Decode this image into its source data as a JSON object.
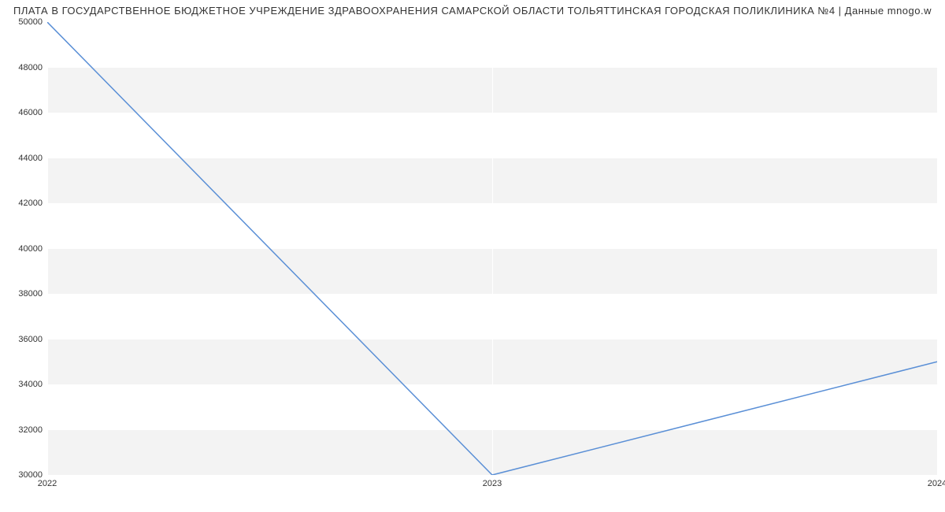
{
  "chart_data": {
    "type": "line",
    "title": "ПЛАТА В ГОСУДАРСТВЕННОЕ БЮДЖЕТНОЕ УЧРЕЖДЕНИЕ ЗДРАВООХРАНЕНИЯ САМАРСКОЙ ОБЛАСТИ ТОЛЬЯТТИНСКАЯ ГОРОДСКАЯ ПОЛИКЛИНИКА №4 | Данные mnogo.w",
    "x": [
      2022,
      2023,
      2024
    ],
    "values": [
      50000,
      30000,
      35000
    ],
    "x_ticks": [
      2022,
      2023,
      2024
    ],
    "y_ticks": [
      30000,
      32000,
      34000,
      36000,
      38000,
      40000,
      42000,
      44000,
      46000,
      48000,
      50000
    ],
    "xlabel": "",
    "ylabel": "",
    "xlim": [
      2022,
      2024
    ],
    "ylim": [
      30000,
      50000
    ],
    "line_color": "#5a8fd6"
  }
}
